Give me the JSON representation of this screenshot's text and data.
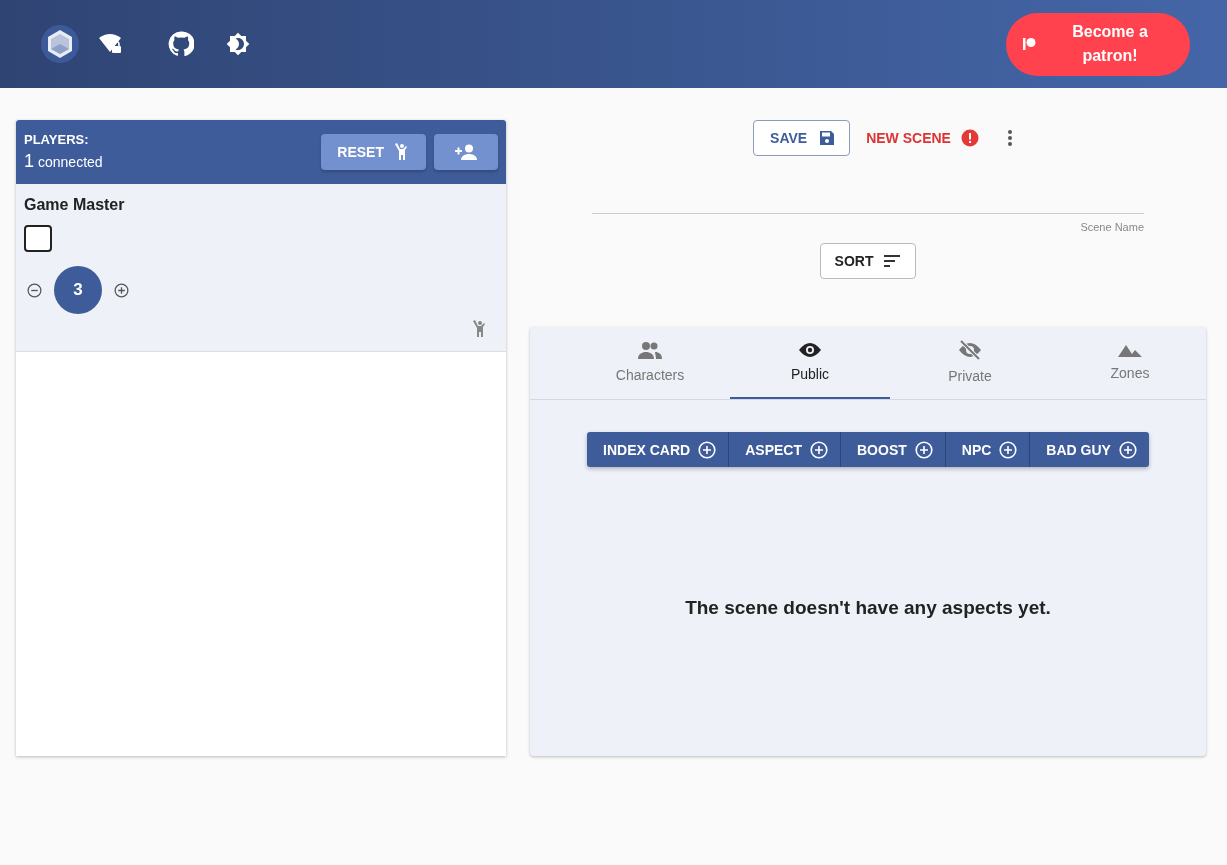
{
  "header": {
    "patron_button": "Become a patron!"
  },
  "players_panel": {
    "title": "PLAYERS:",
    "count": "1",
    "count_label": "connected",
    "reset_button": "RESET",
    "players": [
      {
        "name": "Game Master",
        "checked": false,
        "points": "3"
      }
    ]
  },
  "scene": {
    "save_button": "SAVE",
    "new_scene_button": "NEW SCENE",
    "scene_name_label": "Scene Name",
    "sort_button": "SORT",
    "tabs": [
      {
        "label": "Characters",
        "selected": false
      },
      {
        "label": "Public",
        "selected": true
      },
      {
        "label": "Private",
        "selected": false
      },
      {
        "label": "Zones",
        "selected": false
      }
    ],
    "add_buttons": [
      "INDEX CARD",
      "ASPECT",
      "BOOST",
      "NPC",
      "BAD GUY"
    ],
    "empty_message": "The scene doesn't have any aspects yet."
  }
}
